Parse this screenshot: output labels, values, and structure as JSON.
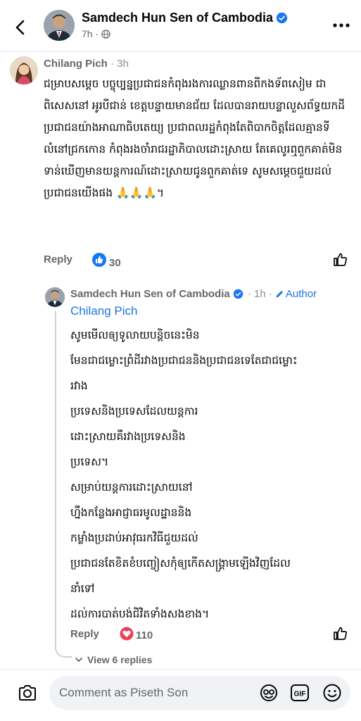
{
  "header": {
    "page_name": "Samdech Hun Sen of Cambodia",
    "post_time": "7h ·"
  },
  "comment": {
    "author": "Chilang Pich",
    "time": "· 3h",
    "text": "ជម្រាបសម្ដេច បច្ចុប្បន្នប្រជាជនកំពុងរងការឈ្លានពានពីកងទ័ពសៀម ជាពិសេសនៅ អូរបីជាន់ ខេត្តបន្ទាយមានជ័យ ដែលបានរាយបន្លាលួសព័ទ្ធយកដីប្រជាជនយ៉ាងអាណាធិបតេយ្យ ប្រជាពលរដ្ឋកំពុងតែពិបាកចិត្តដែលគ្មានទីលំនៅជ្រកកោន កំពុងរងចាំរាជរដ្ឋាភិបាលដោះស្រាយ តែគេលូរឮពួកគាត់មិនទាន់ឃើញមានយន្តការណ៍ដោះស្រាយជូនពួកគាត់ទេ សូមសម្ដេចជួយដល់ប្រជាជនយើងផង 🙏🙏🙏។",
    "reply_label": "Reply",
    "like_count": "30"
  },
  "reply": {
    "author": "Samdech Hun Sen of Cambodia",
    "time": "· 1h ·",
    "author_badge": "Author",
    "mention": "Chilang Pich",
    "lines": [
      "សូមមើលឲ្យទូលាយបន្តិចនេះមិន",
      "មែនជាជម្លោះព្រំដីរវាងប្រជាជននិងប្រជាជនទេតែជាជម្លោះ",
      "រវាង",
      "ប្រទេសនិងប្រទេសដែលយន្តការ",
      "ដោះស្រាយគឺរវាងប្រទេសនិង",
      "ប្រទេស។",
      "សម្រាប់យន្តការដោះស្រាយនៅ",
      "ហ្នឹងកន្លែងអាជ្ញាធរមូលដ្ឋាននិង",
      "កម្លាំងប្រដាប់អាវុធរកវិធីជួយដល់",
      "ប្រជាជនតែខិតខំបញ្ចៀសកុំឲ្យកើតសង្គ្រាមឡើងវិញដែល",
      "នាំទៅ",
      "ដល់ការបាត់បង់ជិវិតទាំងសងខាង។"
    ],
    "reply_label": "Reply",
    "heart_count": "110",
    "view_replies": "View 6 replies"
  },
  "composer": {
    "placeholder": "Comment as Piseth Son",
    "gif_label": "GIF"
  },
  "colors": {
    "link_blue": "#1b74e4",
    "like_blue": "#1877f2",
    "heart_red": "#f33e58",
    "meta_gray": "#65676b"
  }
}
